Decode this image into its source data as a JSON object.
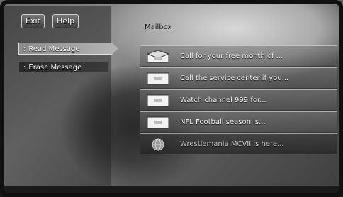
{
  "toolbar": {
    "exit_label": "Exit",
    "help_label": "Help"
  },
  "menu": {
    "items": [
      {
        "label": "Read Message",
        "selected": true
      },
      {
        "label": "Erase Message",
        "selected": false
      }
    ]
  },
  "mailbox": {
    "title": "Mailbox",
    "messages": [
      {
        "text": "Call for your free month of ...",
        "icon": "envelope-open-icon",
        "selected": false
      },
      {
        "text": "Call the service center if you...",
        "icon": "envelope-icon",
        "selected": false
      },
      {
        "text": "Watch channel 999 for...",
        "icon": "envelope-icon",
        "selected": false
      },
      {
        "text": "NFL Football season is...",
        "icon": "envelope-icon",
        "selected": false
      },
      {
        "text": "Wrestlemania MCVII is here...",
        "icon": "globe-icon",
        "selected": true
      }
    ]
  },
  "colors": {
    "highlight": "#b5b5b5",
    "panel": "#6e6e6e",
    "selected_row": "#3a3a3a"
  }
}
